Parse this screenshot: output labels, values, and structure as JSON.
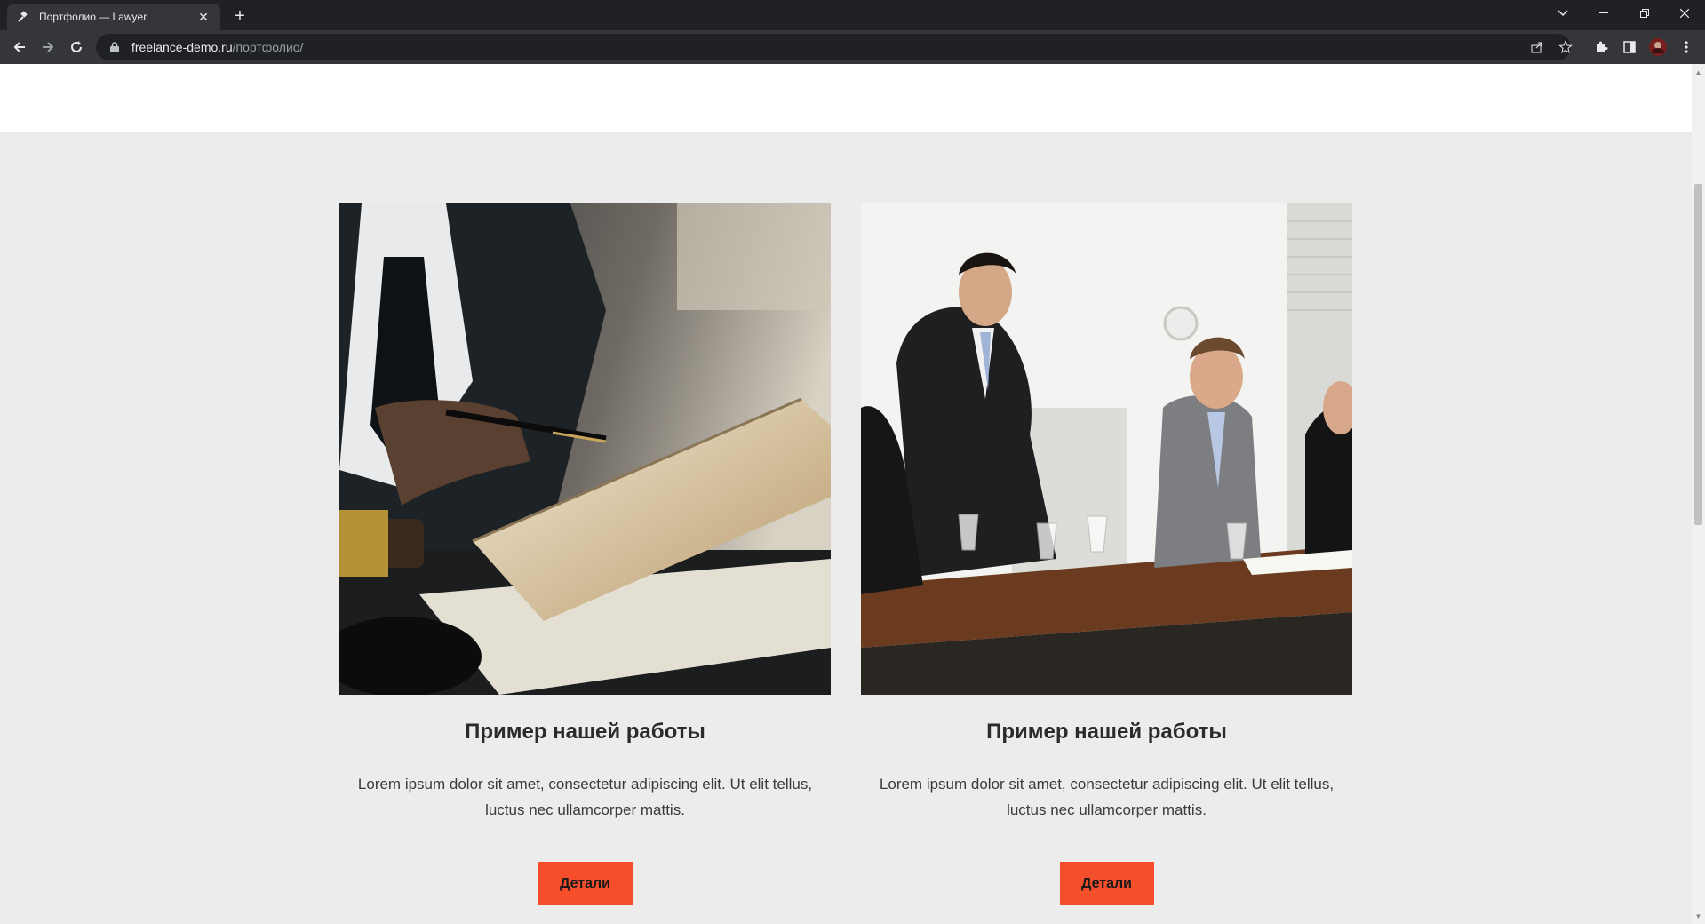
{
  "browser": {
    "tab_title": "Портфолио — Lawyer",
    "tab_close": "✕",
    "new_tab": "+",
    "url_host": "freelance-demo.ru",
    "url_path": "/портфолио/"
  },
  "cards": [
    {
      "title": "Пример нашей работы",
      "text": "Lorem ipsum dolor sit amet, consectetur adipiscing elit. Ut elit tellus, luctus nec ullamcorper mattis.",
      "button": "Детали",
      "image": "lawyer-with-book-and-gavel-photo"
    },
    {
      "title": "Пример нашей работы",
      "text": "Lorem ipsum dolor sit amet, consectetur adipiscing elit. Ut elit tellus, luctus nec ullamcorper mattis.",
      "button": "Детали",
      "image": "business-meeting-photo"
    }
  ],
  "colors": {
    "accent_button": "#f44e2b",
    "page_background": "#ececec",
    "browser_frame": "#202124"
  }
}
